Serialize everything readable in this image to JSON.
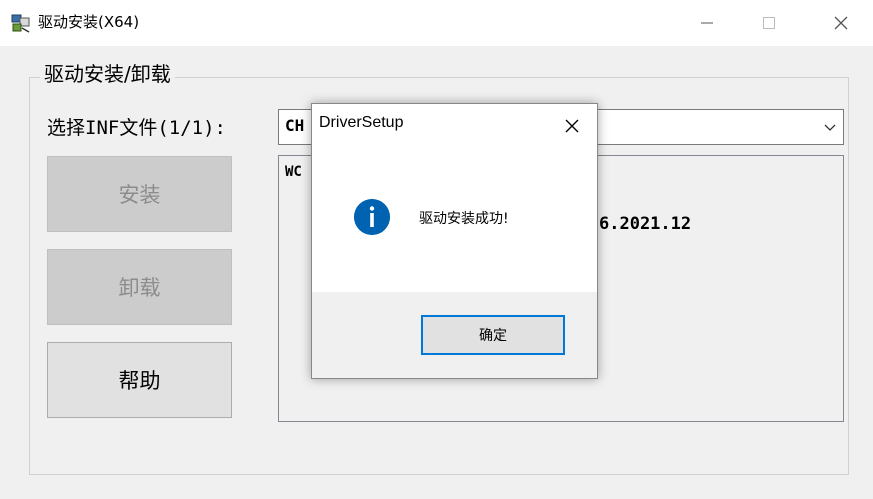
{
  "window": {
    "title": "驱动安装(X64)",
    "icon": "installer-app-icon"
  },
  "group": {
    "legend": "驱动安装/卸载"
  },
  "inf": {
    "label": "选择INF文件(1/1):",
    "selected_value": "CH"
  },
  "buttons": {
    "install": "安装",
    "uninstall": "卸载",
    "help": "帮助"
  },
  "info_panel": {
    "line1": "WC",
    "line2": "6.2021.12"
  },
  "dialog": {
    "title": "DriverSetup",
    "message": "驱动安装成功!",
    "ok_label": "确定",
    "icon": "information-icon"
  },
  "colors": {
    "accent": "#0078d7",
    "info_icon": "#0063b1",
    "disabled_button": "#cccccc"
  }
}
